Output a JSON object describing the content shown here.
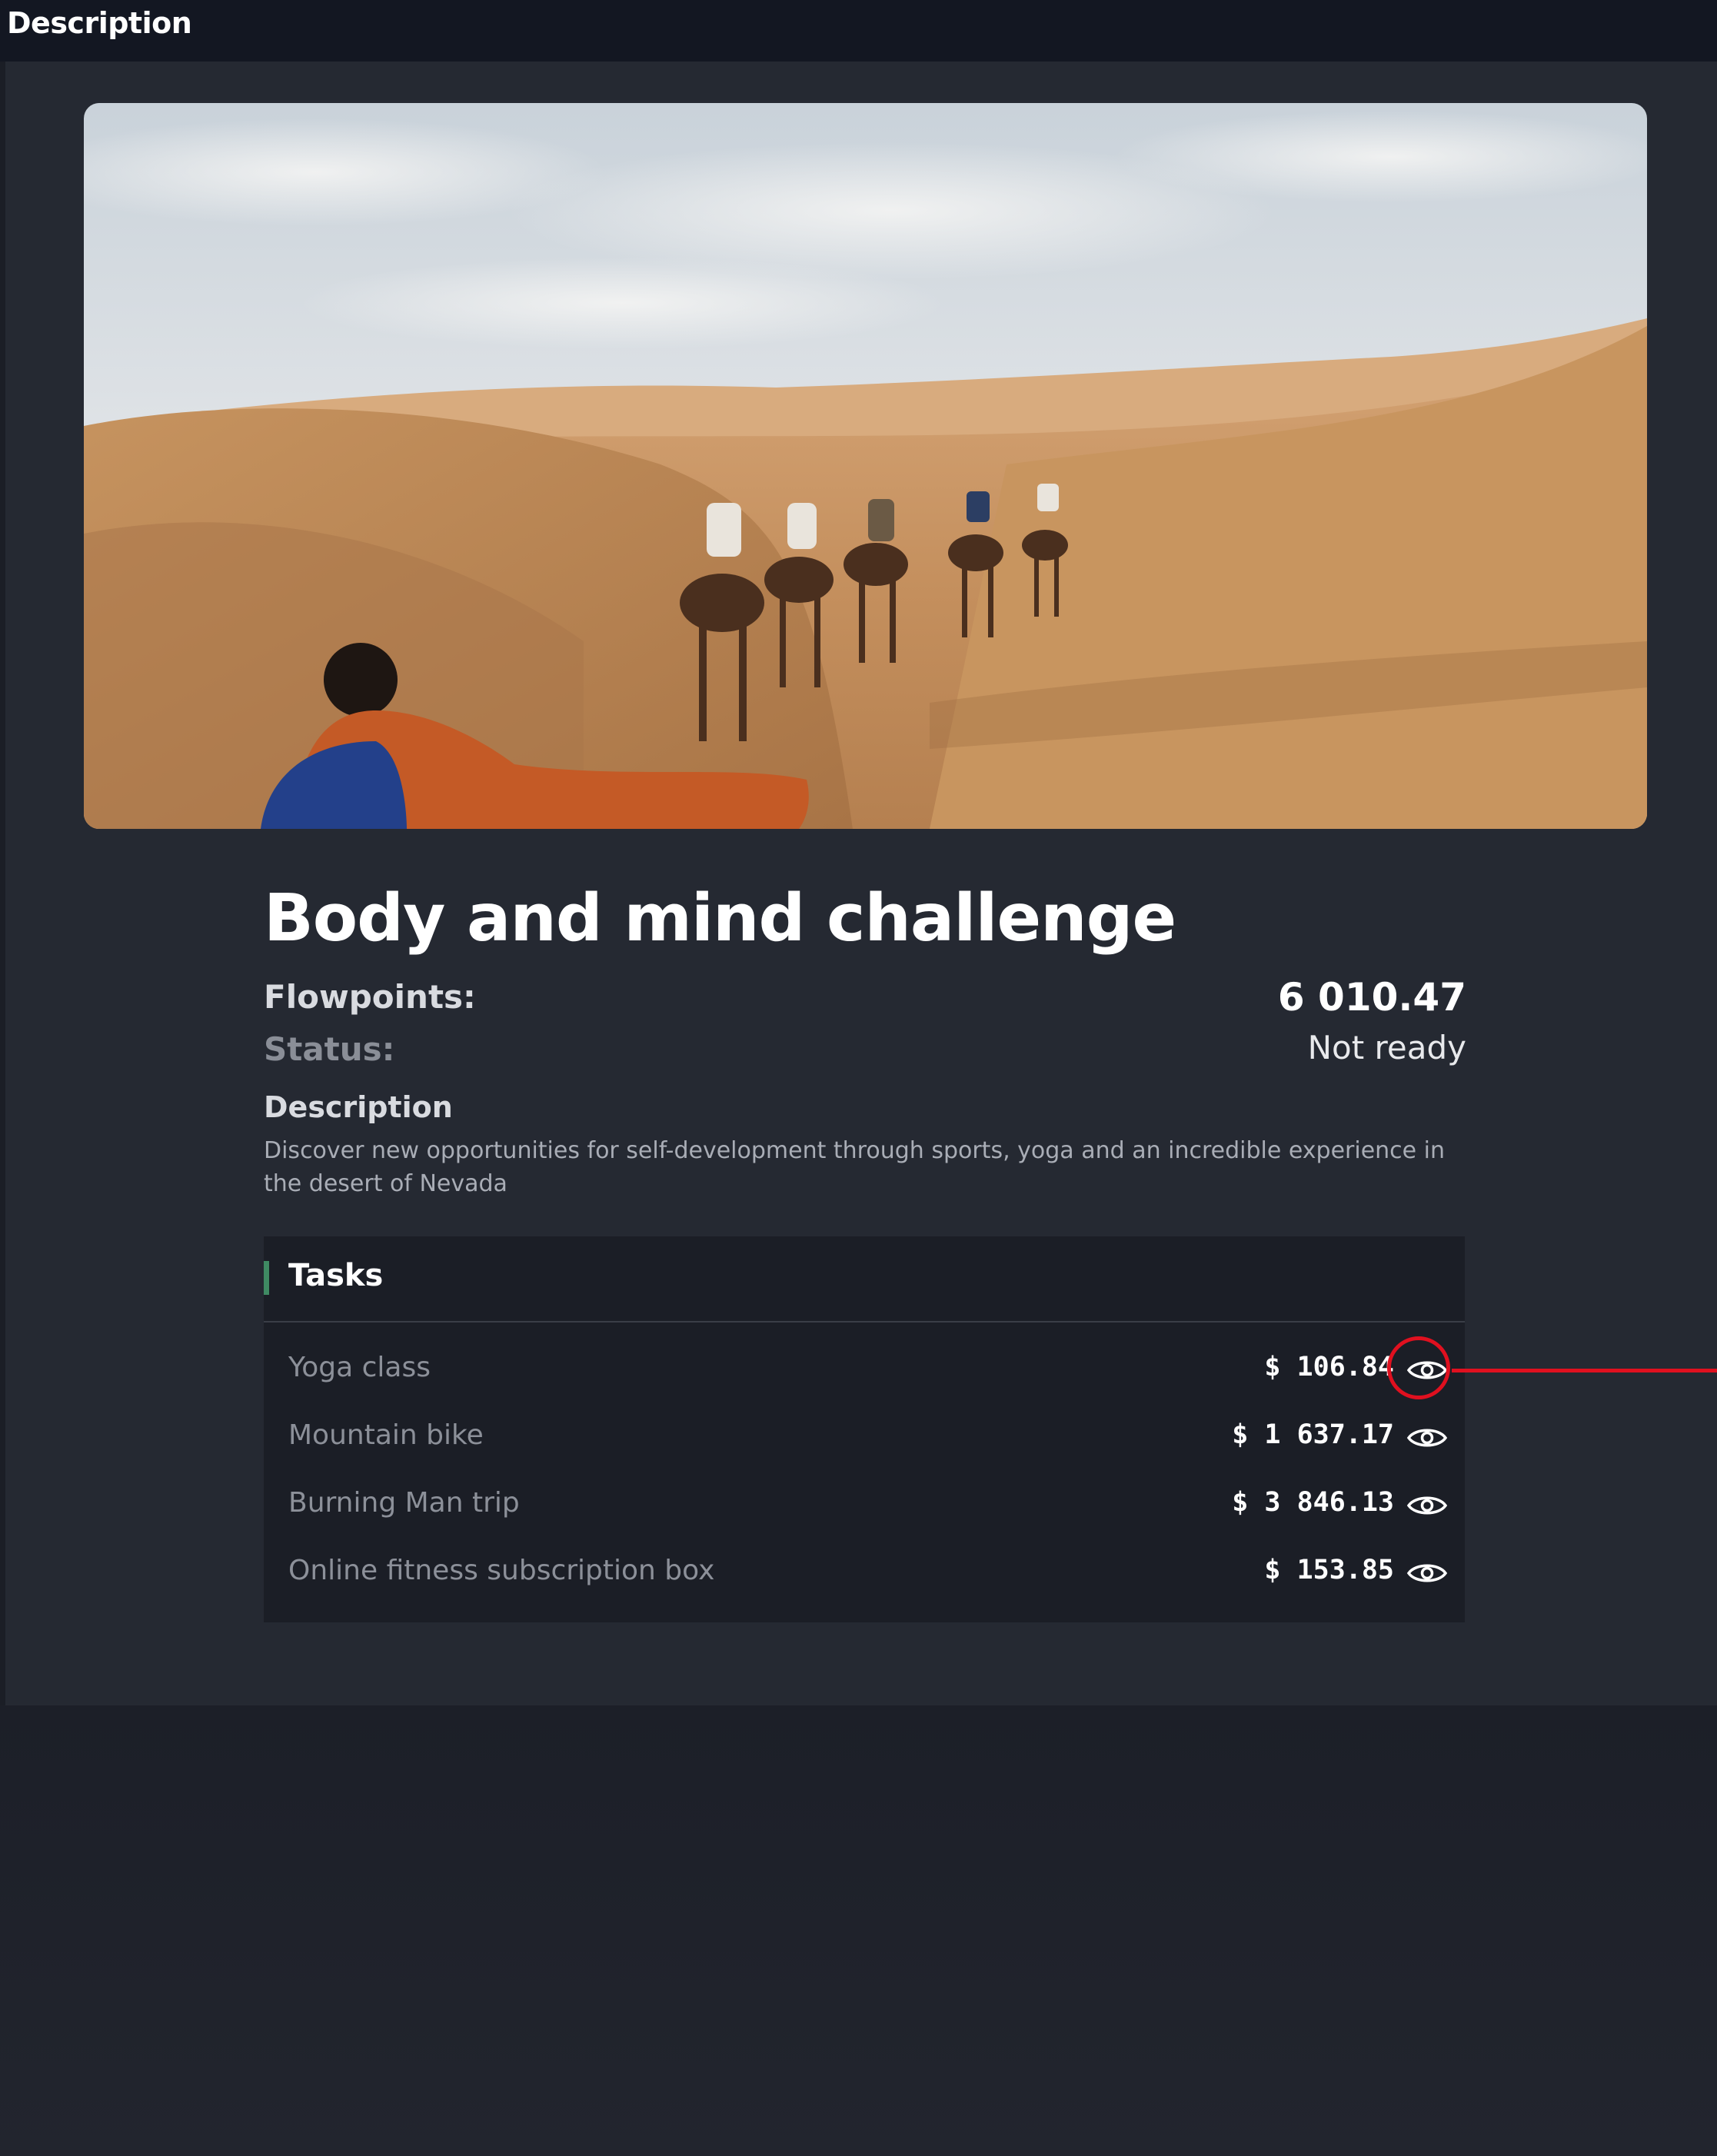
{
  "header": {
    "title": "Description"
  },
  "challenge": {
    "title": "Body and mind challenge",
    "flowpoints_label": "Flowpoints:",
    "flowpoints_value": "6 010.47",
    "status_label": "Status:",
    "status_value": "Not ready",
    "description_heading": "Description",
    "description_text": "Discover new opportunities for self-development through sports, yoga and an incredible experience in the desert of Nevada"
  },
  "tasks": {
    "title": "Tasks",
    "items": [
      {
        "name": "Yoga class",
        "amount": "$ 106.84",
        "icon": "eye-icon"
      },
      {
        "name": "Mountain bike",
        "amount": "$ 1 637.17",
        "icon": "eye-icon"
      },
      {
        "name": "Burning Man trip",
        "amount": "$ 3 846.13",
        "icon": "eye-icon"
      },
      {
        "name": "Online fitness subscription box",
        "amount": "$ 153.85",
        "icon": "eye-icon"
      }
    ]
  },
  "colors": {
    "background": "#1d2029",
    "panel": "#252932",
    "task_card": "#1b1e26",
    "accent_green": "#3f8a63",
    "annotation_red": "#e0101f"
  }
}
